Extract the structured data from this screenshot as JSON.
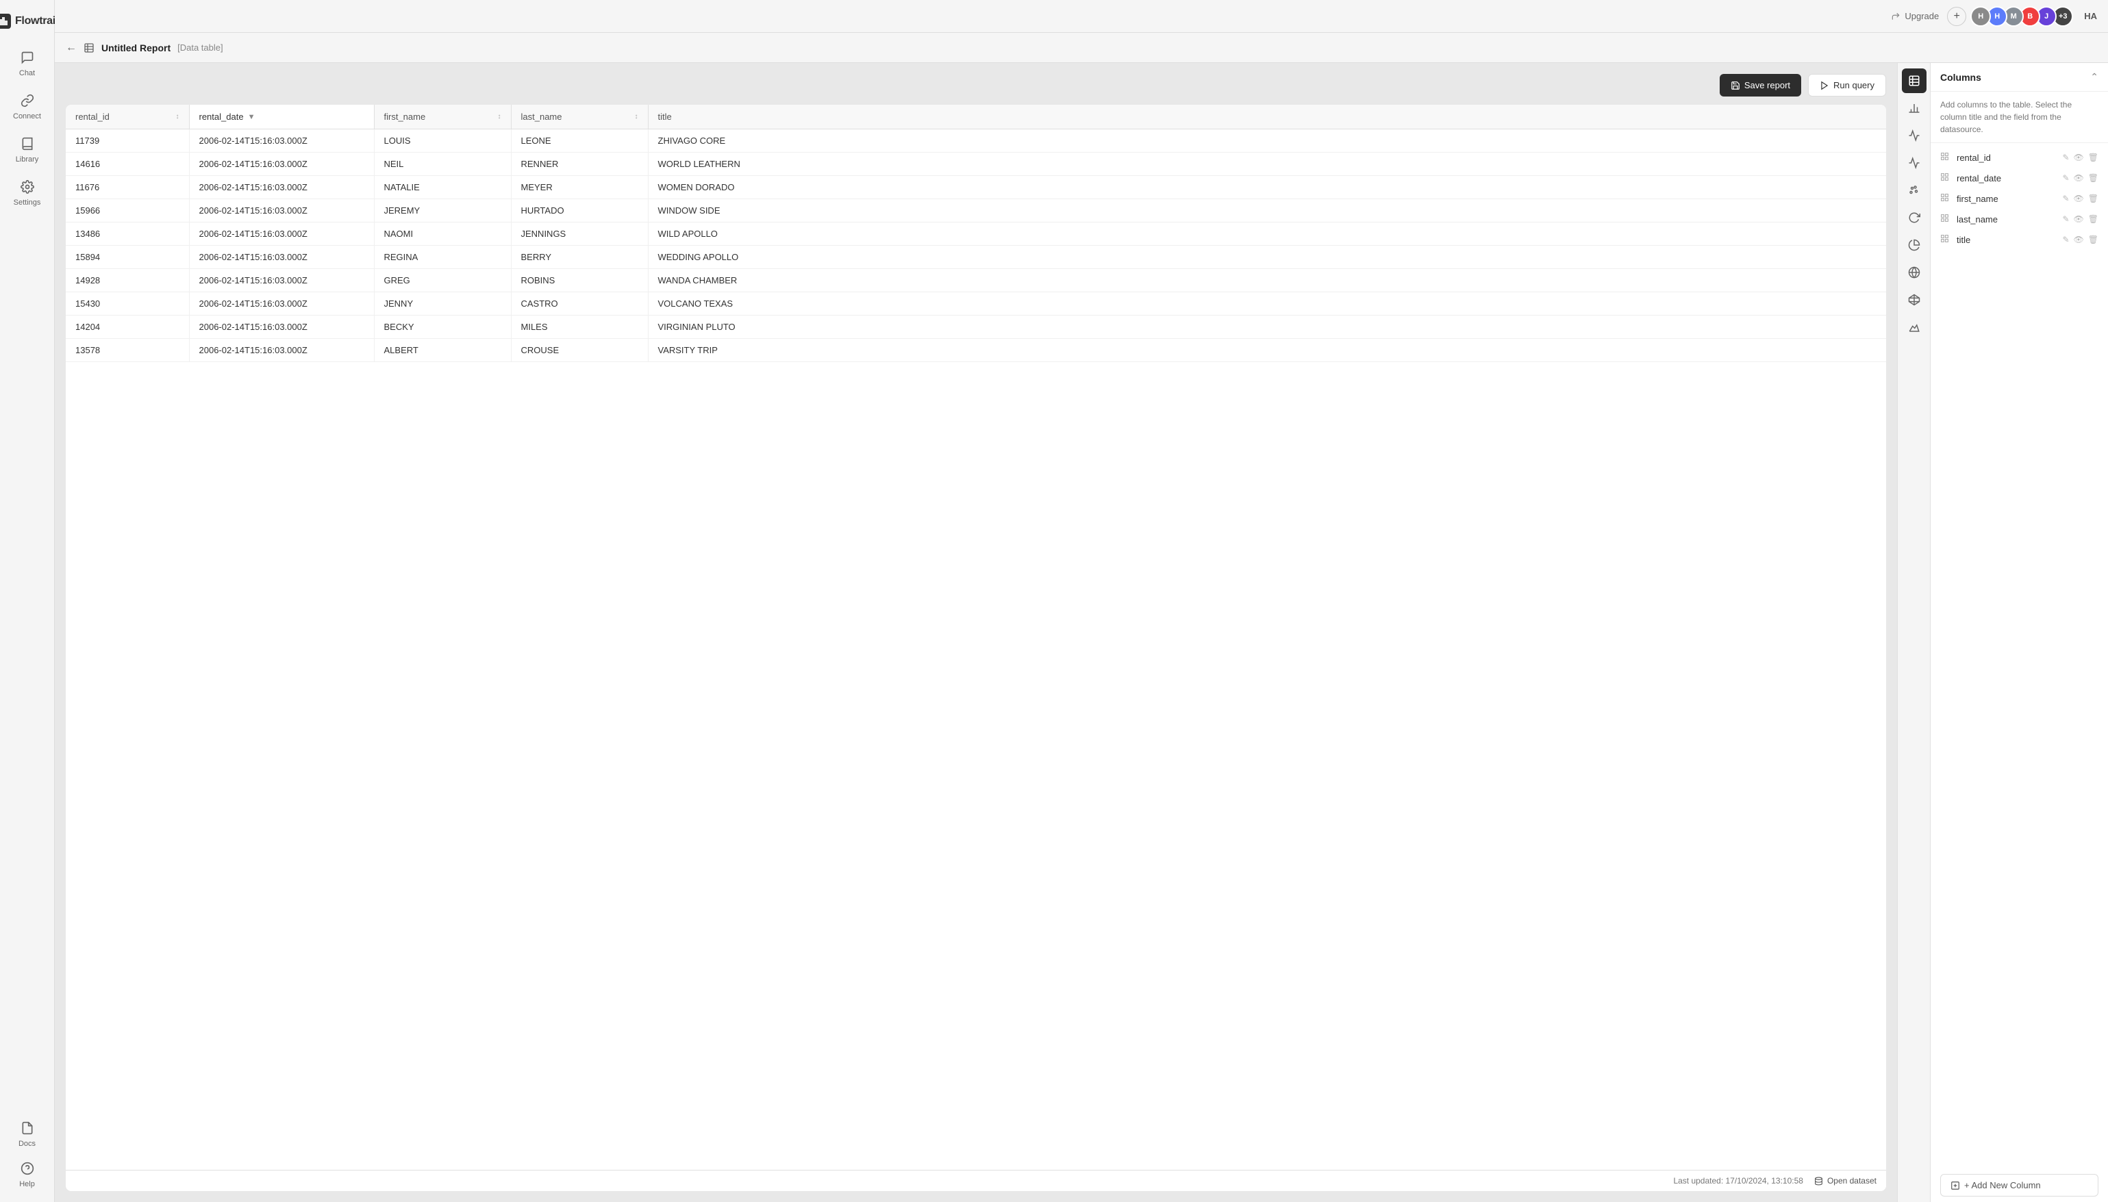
{
  "app": {
    "name": "Flowtrail"
  },
  "topbar": {
    "upgrade_label": "Upgrade",
    "plus_label": "+",
    "initials": "HA",
    "avatars": [
      {
        "initials": "H",
        "color": "#8a8a8a"
      },
      {
        "initials": "H",
        "color": "#5c7cfa"
      },
      {
        "initials": "M",
        "color": "#868e96"
      },
      {
        "initials": "B",
        "color": "#f03e3e"
      },
      {
        "initials": "J",
        "color": "#6741d9"
      },
      {
        "initials": "+3",
        "color": "#444"
      }
    ]
  },
  "report": {
    "title": "Untitled Report",
    "type": "[Data table]",
    "save_label": "Save report",
    "run_label": "Run query"
  },
  "columns_panel": {
    "title": "Columns",
    "description": "Add columns to the table. Select the column title and the field from the datasource.",
    "add_label": "+ Add New Column",
    "columns": [
      {
        "name": "rental_id"
      },
      {
        "name": "rental_date"
      },
      {
        "name": "first_name"
      },
      {
        "name": "last_name"
      },
      {
        "name": "title"
      }
    ]
  },
  "table": {
    "headers": [
      "rental_id",
      "rental_date",
      "first_name",
      "last_name",
      "title"
    ],
    "rows": [
      {
        "rental_id": "11739",
        "rental_date": "2006-02-14T15:16:03.000Z",
        "first_name": "LOUIS",
        "last_name": "LEONE",
        "title": "ZHIVAGO CORE"
      },
      {
        "rental_id": "14616",
        "rental_date": "2006-02-14T15:16:03.000Z",
        "first_name": "NEIL",
        "last_name": "RENNER",
        "title": "WORLD LEATHERN"
      },
      {
        "rental_id": "11676",
        "rental_date": "2006-02-14T15:16:03.000Z",
        "first_name": "NATALIE",
        "last_name": "MEYER",
        "title": "WOMEN DORADO"
      },
      {
        "rental_id": "15966",
        "rental_date": "2006-02-14T15:16:03.000Z",
        "first_name": "JEREMY",
        "last_name": "HURTADO",
        "title": "WINDOW SIDE"
      },
      {
        "rental_id": "13486",
        "rental_date": "2006-02-14T15:16:03.000Z",
        "first_name": "NAOMI",
        "last_name": "JENNINGS",
        "title": "WILD APOLLO"
      },
      {
        "rental_id": "15894",
        "rental_date": "2006-02-14T15:16:03.000Z",
        "first_name": "REGINA",
        "last_name": "BERRY",
        "title": "WEDDING APOLLO"
      },
      {
        "rental_id": "14928",
        "rental_date": "2006-02-14T15:16:03.000Z",
        "first_name": "GREG",
        "last_name": "ROBINS",
        "title": "WANDA CHAMBER"
      },
      {
        "rental_id": "15430",
        "rental_date": "2006-02-14T15:16:03.000Z",
        "first_name": "JENNY",
        "last_name": "CASTRO",
        "title": "VOLCANO TEXAS"
      },
      {
        "rental_id": "14204",
        "rental_date": "2006-02-14T15:16:03.000Z",
        "first_name": "BECKY",
        "last_name": "MILES",
        "title": "VIRGINIAN PLUTO"
      },
      {
        "rental_id": "13578",
        "rental_date": "2006-02-14T15:16:03.000Z",
        "first_name": "ALBERT",
        "last_name": "CROUSE",
        "title": "VARSITY TRIP"
      }
    ]
  },
  "status_bar": {
    "last_updated": "Last updated: 17/10/2024, 13:10:58",
    "open_dataset": "Open dataset"
  },
  "sidebar": {
    "items": [
      {
        "id": "chat",
        "label": "Chat",
        "icon": "💬"
      },
      {
        "id": "connect",
        "label": "Connect",
        "icon": "🔗"
      },
      {
        "id": "library",
        "label": "Library",
        "icon": "📚"
      },
      {
        "id": "settings",
        "label": "Settings",
        "icon": "⚙️"
      }
    ],
    "bottom_items": [
      {
        "id": "docs",
        "label": "Docs",
        "icon": "📄"
      },
      {
        "id": "help",
        "label": "Help",
        "icon": "❓"
      }
    ]
  }
}
